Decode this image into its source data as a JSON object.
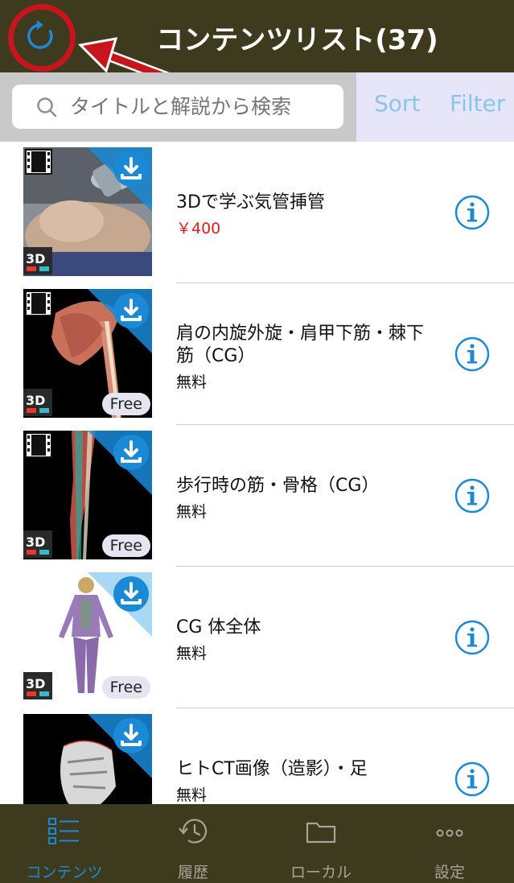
{
  "header": {
    "title": "コンテンツリスト(37)",
    "refresh_icon": "refresh-icon",
    "annotation": "red-arrow-pointing-to-refresh"
  },
  "search": {
    "placeholder": "タイトルと解説から検索",
    "sort_label": "Sort",
    "filter_label": "Filter"
  },
  "items": [
    {
      "title": "3Dで学ぶ気管挿管",
      "price": "￥400",
      "paid": true,
      "video": true,
      "badge_3d": "3D",
      "free_badge": ""
    },
    {
      "title": "肩の内旋外旋・肩甲下筋・棘下筋（CG）",
      "price": "無料",
      "paid": false,
      "video": true,
      "badge_3d": "3D",
      "free_badge": "Free"
    },
    {
      "title": "歩行時の筋・骨格（CG）",
      "price": "無料",
      "paid": false,
      "video": true,
      "badge_3d": "3D",
      "free_badge": "Free"
    },
    {
      "title": "CG 体全体",
      "price": "無料",
      "paid": false,
      "video": false,
      "badge_3d": "3D",
      "free_badge": "Free"
    },
    {
      "title": "ヒトCT画像（造影）・足",
      "price": "無料",
      "paid": false,
      "video": false,
      "badge_3d": "",
      "free_badge": ""
    }
  ],
  "tabs": [
    {
      "label": "コンテンツ",
      "icon": "list-icon",
      "active": true
    },
    {
      "label": "履歴",
      "icon": "history-icon",
      "active": false
    },
    {
      "label": "ローカル",
      "icon": "folder-icon",
      "active": false
    },
    {
      "label": "設定",
      "icon": "more-icon",
      "active": false
    }
  ],
  "colors": {
    "bar_bg": "#3e3a1e",
    "accent": "#1a8ad6",
    "price_red": "#e21b1b",
    "annotation_red": "#c8141c"
  }
}
